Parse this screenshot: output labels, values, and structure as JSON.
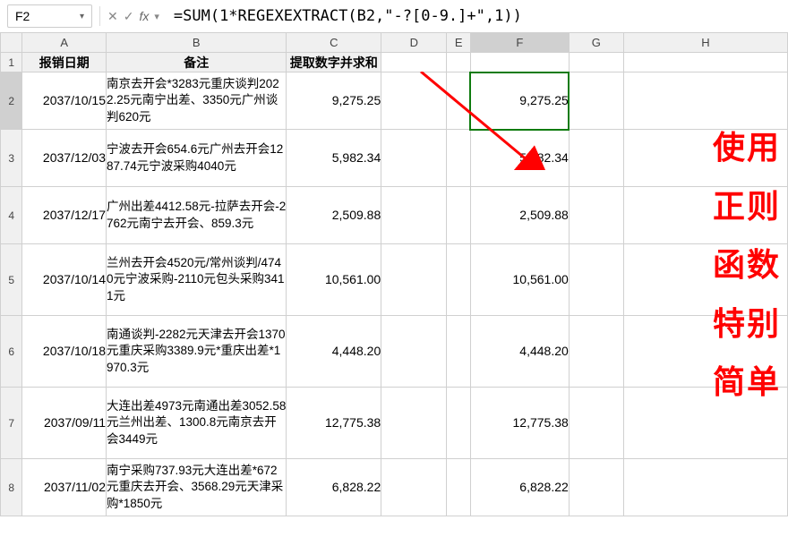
{
  "nameBox": "F2",
  "formula": "=SUM(1*REGEXEXTRACT(B2,\"-?[0-9.]+\",1))",
  "columns": [
    "A",
    "B",
    "C",
    "D",
    "E",
    "F",
    "G",
    "H"
  ],
  "activeCol": "F",
  "rows": [
    "1",
    "2",
    "3",
    "4",
    "5",
    "6",
    "7",
    "8"
  ],
  "activeRow": "2",
  "headers": {
    "A": "报销日期",
    "B": "备注",
    "C": "提取数字并求和"
  },
  "data": [
    {
      "date": "2037/10/15",
      "note": "南京去开会*3283元重庆谈判2022.25元南宁出差、3350元广州谈判620元",
      "c": "9,275.25",
      "f": "9,275.25"
    },
    {
      "date": "2037/12/03",
      "note": "宁波去开会654.6元广州去开会1287.74元宁波采购4040元",
      "c": "5,982.34",
      "f": "5,982.34"
    },
    {
      "date": "2037/12/17",
      "note": "广州出差4412.58元-拉萨去开会-2762元南宁去开会、859.3元",
      "c": "2,509.88",
      "f": "2,509.88"
    },
    {
      "date": "2037/10/14",
      "note": "兰州去开会4520元/常州谈判/4740元宁波采购-2110元包头采购3411元",
      "c": "10,561.00",
      "f": "10,561.00"
    },
    {
      "date": "2037/10/18",
      "note": "南通谈判-2282元天津去开会1370元重庆采购3389.9元*重庆出差*1970.3元",
      "c": "4,448.20",
      "f": "4,448.20"
    },
    {
      "date": "2037/09/11",
      "note": "大连出差4973元南通出差3052.58元兰州出差、1300.8元南京去开会3449元",
      "c": "12,775.38",
      "f": "12,775.38"
    },
    {
      "date": "2037/11/02",
      "note": "南宁采购737.93元大连出差*672元重庆去开会、3568.29元天津采购*1850元",
      "c": "6,828.22",
      "f": "6,828.22"
    }
  ],
  "bigLabel": [
    "使用",
    "正则",
    "函数",
    "特别",
    "简单"
  ]
}
